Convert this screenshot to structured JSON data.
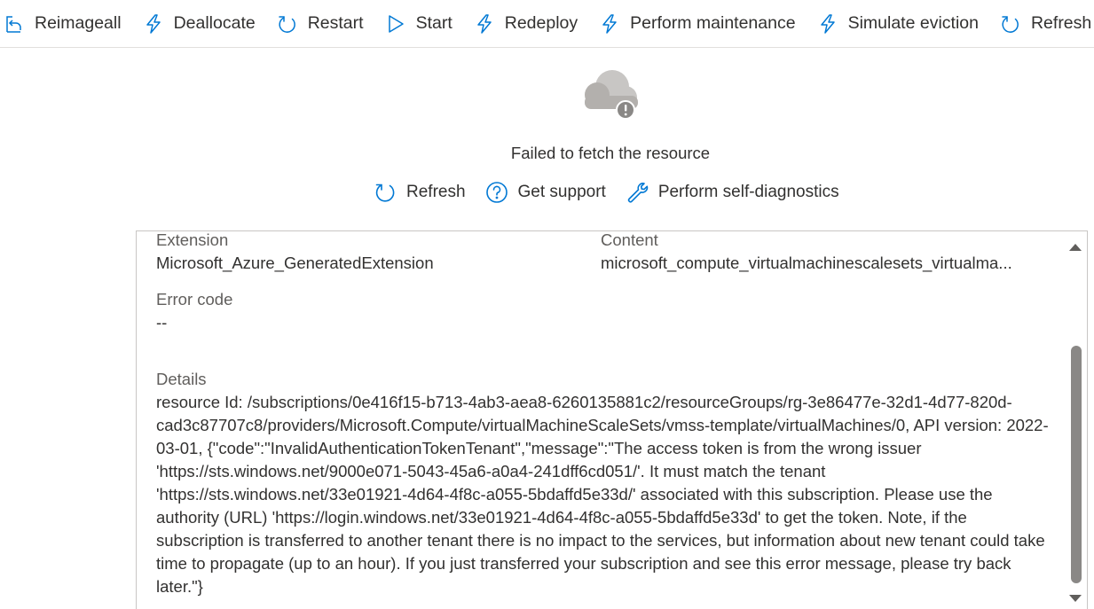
{
  "toolbar": {
    "items": [
      {
        "label": "Reimageall",
        "icon": "reimage-icon"
      },
      {
        "label": "Deallocate",
        "icon": "lightning-icon"
      },
      {
        "label": "Restart",
        "icon": "restart-icon"
      },
      {
        "label": "Start",
        "icon": "play-icon"
      },
      {
        "label": "Redeploy",
        "icon": "lightning-icon"
      },
      {
        "label": "Perform maintenance",
        "icon": "lightning-icon"
      },
      {
        "label": "Simulate eviction",
        "icon": "lightning-icon"
      },
      {
        "label": "Refresh",
        "icon": "refresh-icon"
      }
    ]
  },
  "error": {
    "icon": "cloud-warning-icon",
    "message": "Failed to fetch the resource",
    "actions": [
      {
        "label": "Refresh",
        "icon": "refresh-icon"
      },
      {
        "label": "Get support",
        "icon": "question-circle-icon"
      },
      {
        "label": "Perform self-diagnostics",
        "icon": "wrench-icon"
      }
    ]
  },
  "details": {
    "extension_label": "Extension",
    "extension_value": "Microsoft_Azure_GeneratedExtension",
    "content_label": "Content",
    "content_value": "microsoft_compute_virtualmachinescalesets_virtualma...",
    "error_code_label": "Error code",
    "error_code_value": "--",
    "details_label": "Details",
    "details_value": "resource Id: /subscriptions/0e416f15-b713-4ab3-aea8-6260135881c2/resourceGroups/rg-3e86477e-32d1-4d77-820d-cad3c87707c8/providers/Microsoft.Compute/virtualMachineScaleSets/vmss-template/virtualMachines/0, API version: 2022-03-01, {\"code\":\"InvalidAuthenticationTokenTenant\",\"message\":\"The access token is from the wrong issuer 'https://sts.windows.net/9000e071-5043-45a6-a0a4-241dff6cd051/'. It must match the tenant 'https://sts.windows.net/33e01921-4d64-4f8c-a055-5bdaffd5e33d/' associated with this subscription. Please use the authority (URL) 'https://login.windows.net/33e01921-4d64-4f8c-a055-5bdaffd5e33d' to get the token. Note, if the subscription is transferred to another tenant there is no impact to the services, but information about new tenant could take time to propagate (up to an hour). If you just transferred your subscription and see this error message, please try back later.\"}"
  },
  "colors": {
    "accent": "#0078d4",
    "text": "#323130",
    "label": "#605e5c",
    "border": "#c8c6c4",
    "scrollbar": "#8a8886"
  }
}
